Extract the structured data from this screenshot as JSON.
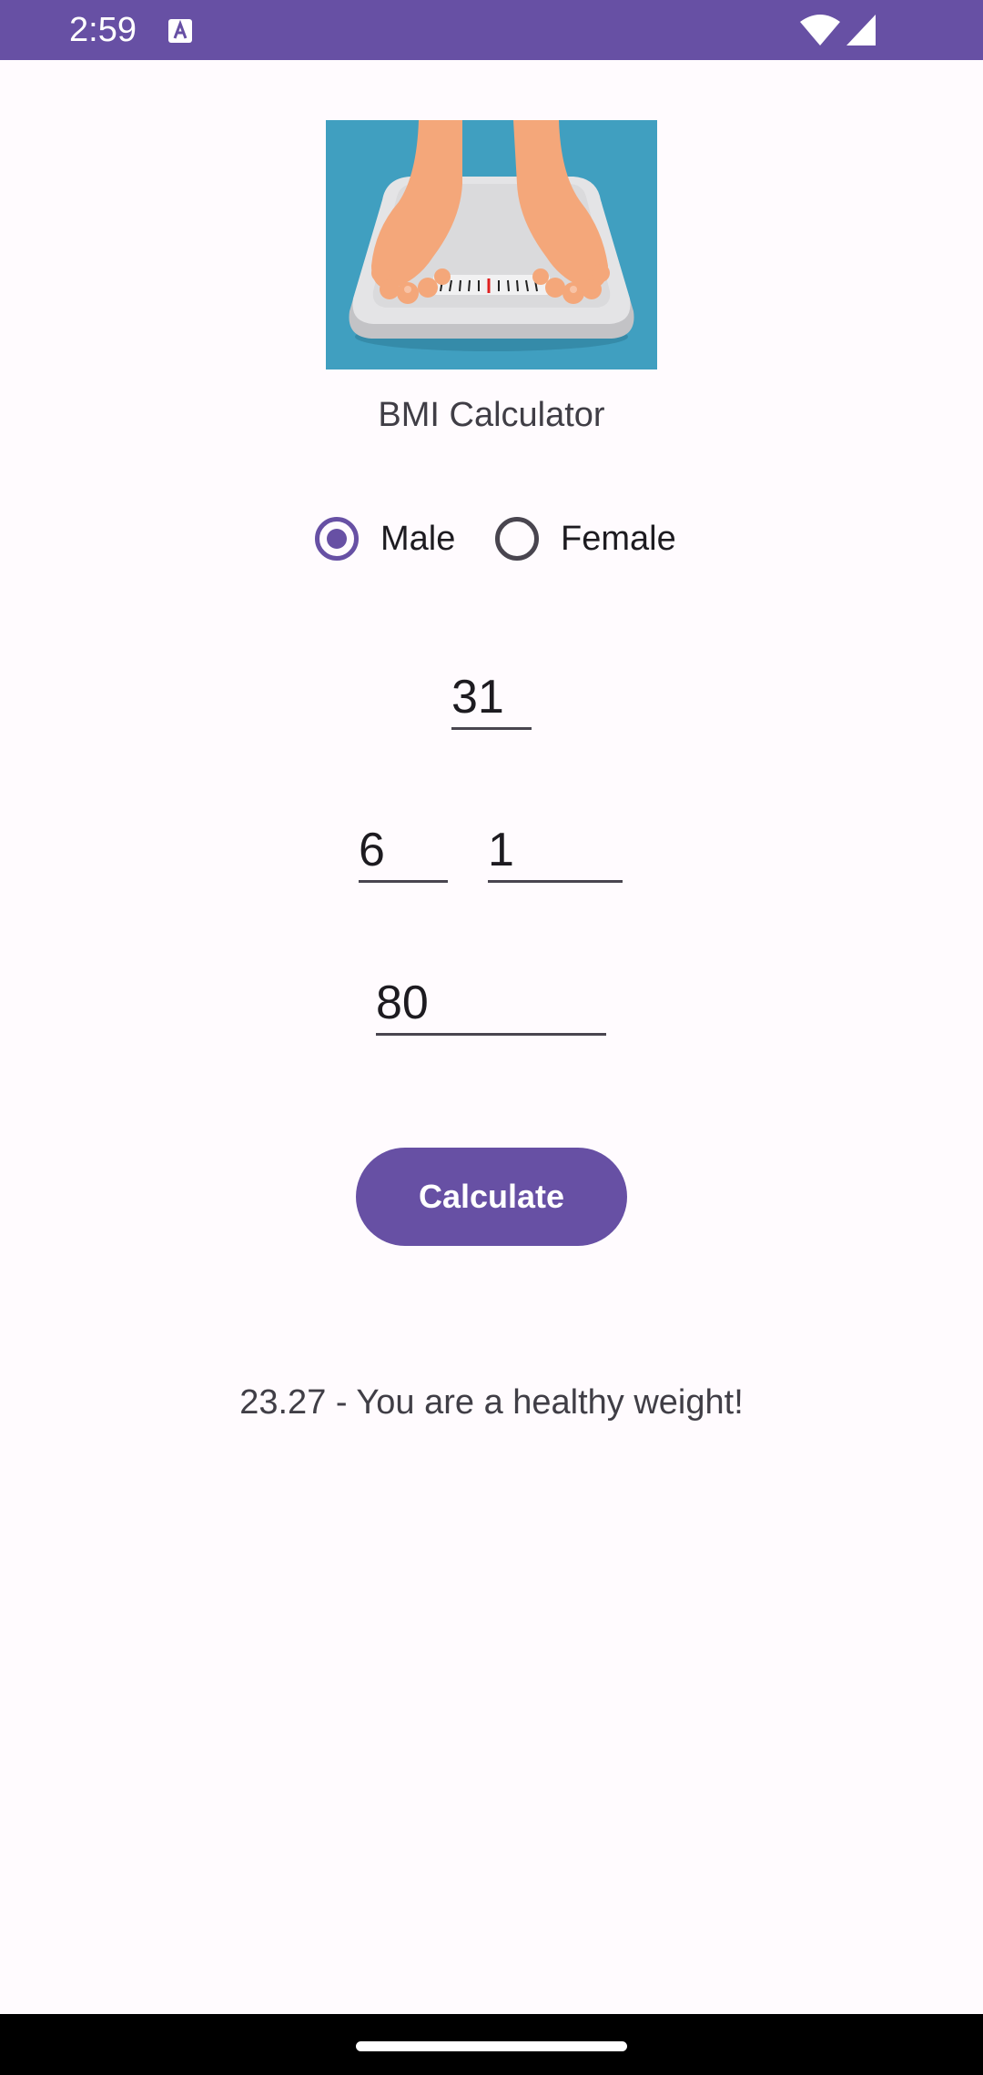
{
  "status_bar": {
    "time": "2:59",
    "color": "#6750a4"
  },
  "app": {
    "title": "BMI Calculator",
    "accent_color": "#6750a4"
  },
  "gender": {
    "options": [
      {
        "label": "Male",
        "selected": true
      },
      {
        "label": "Female",
        "selected": false
      }
    ]
  },
  "inputs": {
    "age": "31",
    "height_feet": "6",
    "height_inches": "1",
    "weight": "80"
  },
  "actions": {
    "calculate_label": "Calculate"
  },
  "result": {
    "text": "23.27 - You are a healthy weight!"
  },
  "icons": {
    "hero_image": "bathroom-scale-feet-illustration",
    "wifi": "wifi-icon",
    "signal": "cell-signal-icon",
    "notification": "a-notification-icon"
  }
}
